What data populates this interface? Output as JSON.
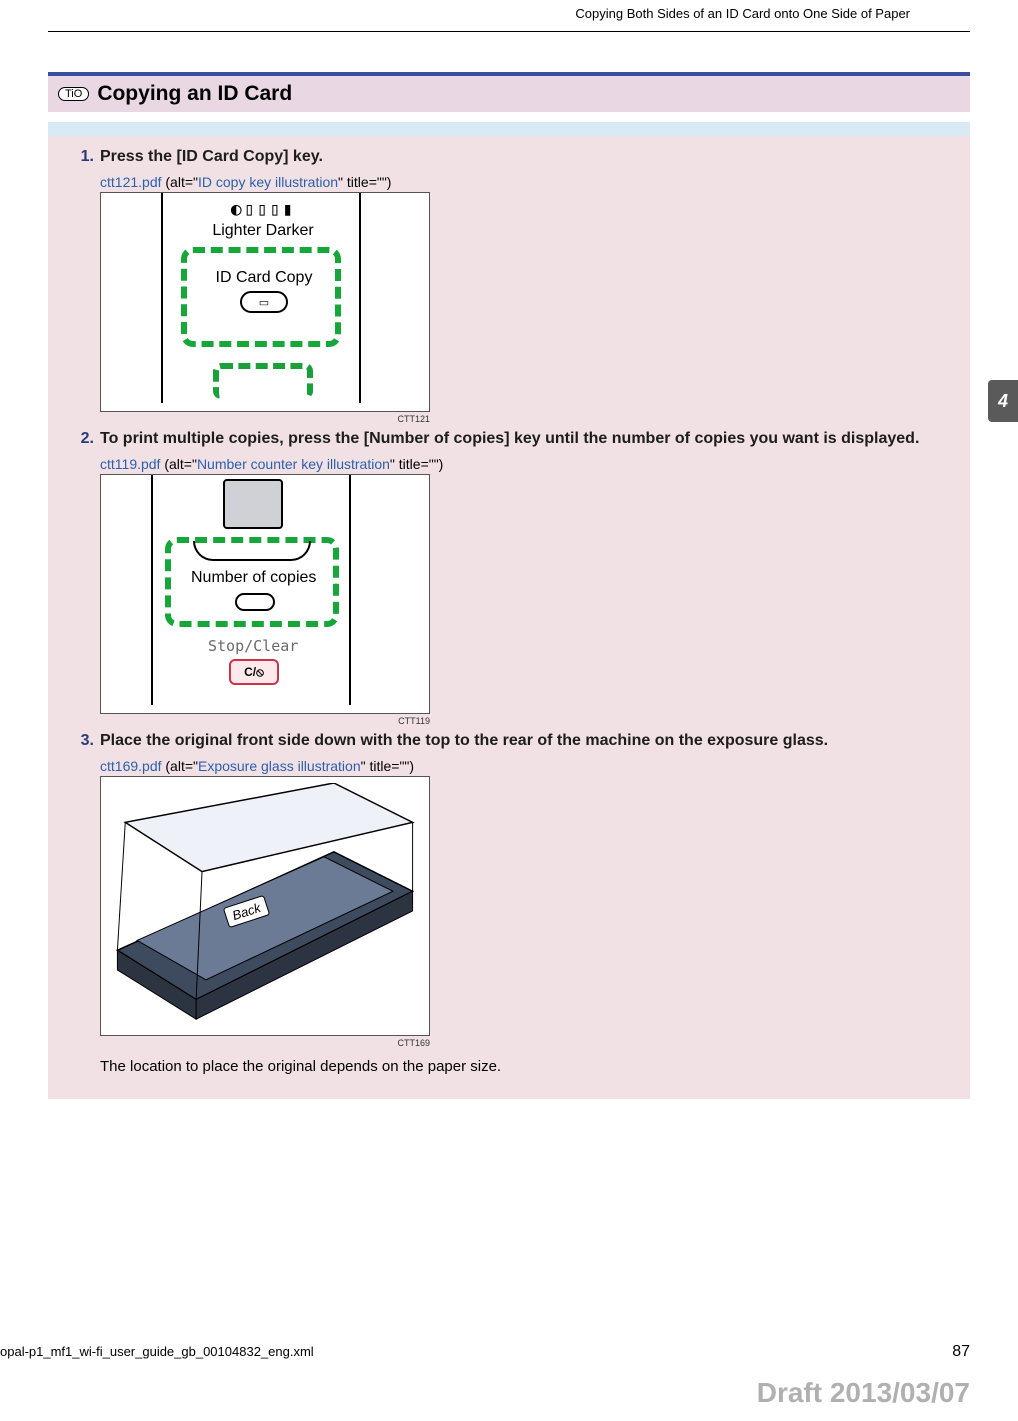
{
  "header": {
    "breadcrumb": "Copying Both Sides of an ID Card onto One Side of Paper"
  },
  "section": {
    "pill": "TiO",
    "title": "Copying an ID Card"
  },
  "steps": {
    "s1": {
      "num": "1.",
      "title": "Press the [ID Card Copy] key.",
      "img_file": "ctt121.pdf",
      "img_alt_prefix": " (alt=\"",
      "img_alt": "ID copy key illustration",
      "img_alt_suffix": "\" title=\"\")",
      "img_code": "CTT121",
      "illus": {
        "lighter_darker": "Lighter   Darker",
        "btn_label": "ID Card Copy",
        "icon_glyph": "▭"
      }
    },
    "s2": {
      "num": "2.",
      "title": "To print multiple copies, press the [Number of copies] key until the number of copies you want is displayed.",
      "img_file": "ctt119.pdf",
      "img_alt_prefix": " (alt=\"",
      "img_alt": "Number counter key illustration",
      "img_alt_suffix": "\" title=\"\")",
      "img_code": "CTT119",
      "illus": {
        "label": "Number of copies",
        "stop": "Stop/Clear",
        "btn_glyph": "C/⦸"
      }
    },
    "s3": {
      "num": "3.",
      "title": "Place the original front side down with the top to the rear of the machine on the exposure glass.",
      "img_file": "ctt169.pdf",
      "img_alt_prefix": " (alt=\"",
      "img_alt": "Exposure glass illustration",
      "img_alt_suffix": "\" title=\"\")",
      "img_code": "CTT169",
      "illus": {
        "back_label": "Back"
      },
      "followup": "The location to place the original depends on the paper size."
    }
  },
  "chapter_tab": "4",
  "footer": {
    "filename": "opal-p1_mf1_wi-fi_user_guide_gb_00104832_eng.xml",
    "page": "87"
  },
  "draft": "Draft 2013/03/07"
}
